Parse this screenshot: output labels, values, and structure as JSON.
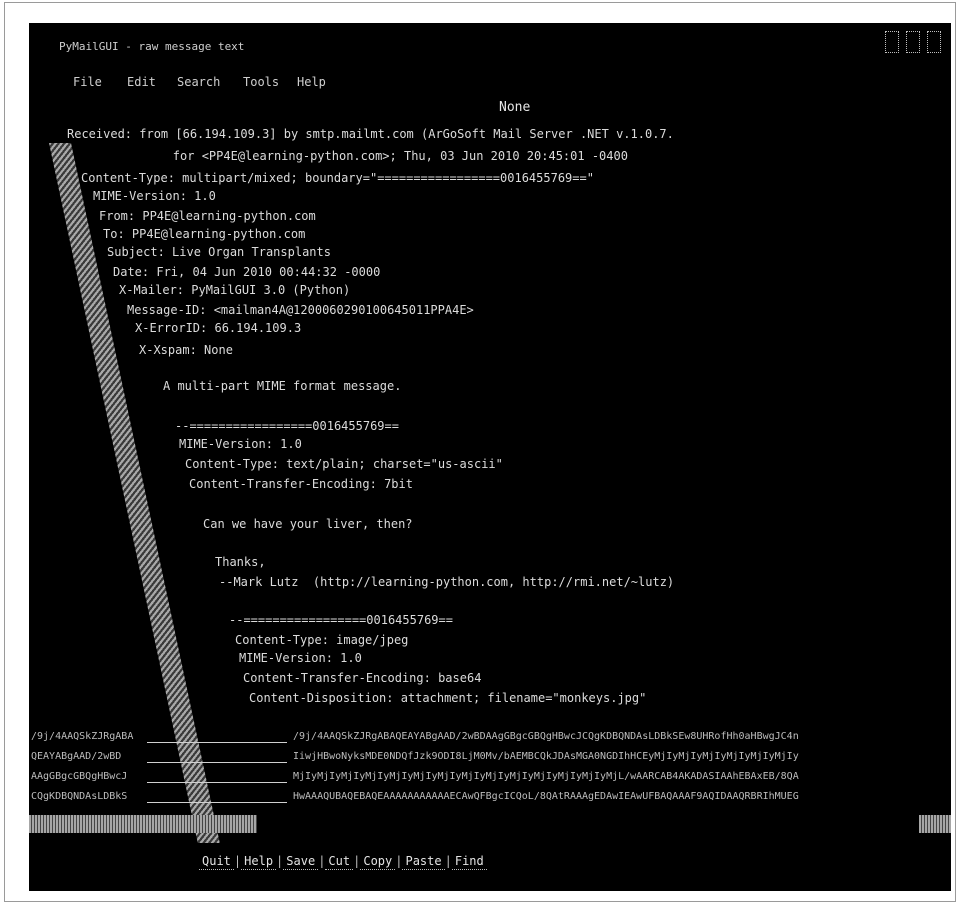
{
  "window": {
    "title": "PyMailGUI - raw message text",
    "controls": [
      "minimize-icon",
      "maximize-icon",
      "close-icon"
    ]
  },
  "menu": [
    "File",
    "Edit",
    "Search",
    "Tools",
    "Help"
  ],
  "message_title": "None",
  "headers": [
    "Received: from [66.194.109.3] by smtp.mailmt.com (ArGoSoft Mail Server .NET v.1.0.7.",
    "        for <PP4E@learning-python.com>; Thu, 03 Jun 2010 20:45:01 -0400",
    "Content-Type: multipart/mixed; boundary=\"=================0016455769==\"",
    "MIME-Version: 1.0",
    "From: PP4E@learning-python.com",
    "To: PP4E@learning-python.com",
    "Subject: Live Organ Transplants",
    "Date: Fri, 04 Jun 2010 00:44:32 -0000",
    "X-Mailer: PyMailGUI 3.0 (Python)",
    "Message-ID: <mailman4A@1200060290100645011PPA4E>",
    "X-ErrorID: 66.194.109.3",
    "X-Xspam: None"
  ],
  "body_intro": "A multi-part MIME format message.",
  "part1": [
    "--=================0016455769==",
    "MIME-Version: 1.0",
    "Content-Type: text/plain; charset=\"us-ascii\"",
    "Content-Transfer-Encoding: 7bit"
  ],
  "part1_text": "Can we have your liver, then?",
  "signature": [
    "Thanks,",
    "--Mark Lutz  (http://learning-python.com, http://rmi.net/~lutz)"
  ],
  "part2": [
    "--=================0016455769==",
    "Content-Type: image/jpeg",
    "MIME-Version: 1.0",
    "Content-Transfer-Encoding: base64",
    "Content-Disposition: attachment; filename=\"monkeys.jpg\""
  ],
  "base64_left": [
    "/9j/4AAQSkZJRgABA",
    "QEAYABgAAD/2wBD",
    "AAgGBgcGBQgHBwcJ",
    "CQgKDBQNDAsLDBkS"
  ],
  "base64_right": [
    "/9j/4AAQSkZJRgABAQEAYABgAAD/2wBDAAgGBgcGBQgHBwcJCQgKDBQNDAsLDBkSEw8UHRofHh0aHBwgJC4n",
    "IiwjHBwoNyksMDE0NDQfJzk9ODI8LjM0Mv/bAEMBCQkJDAsMGA0NGDIhHCEyMjIyMjIyMjIyMjIyMjIyMjIy",
    "MjIyMjIyMjIyMjIyMjIyMjIyMjIyMjIyMjIyMjIyMjIyMjIyMjIyMjL/wAARCAB4AKADASIAAhEBAxEB/8QA",
    "HwAAAQUBAQEBAQEAAAAAAAAAAAECAwQFBgcICQoL/8QAtRAAAgEDAwIEAwUFBAQAAAF9AQIDAAQRBRIhMUEG"
  ],
  "toolbar": [
    "Quit",
    "Help",
    "Save",
    "Cut",
    "Copy",
    "Paste",
    "Find"
  ]
}
